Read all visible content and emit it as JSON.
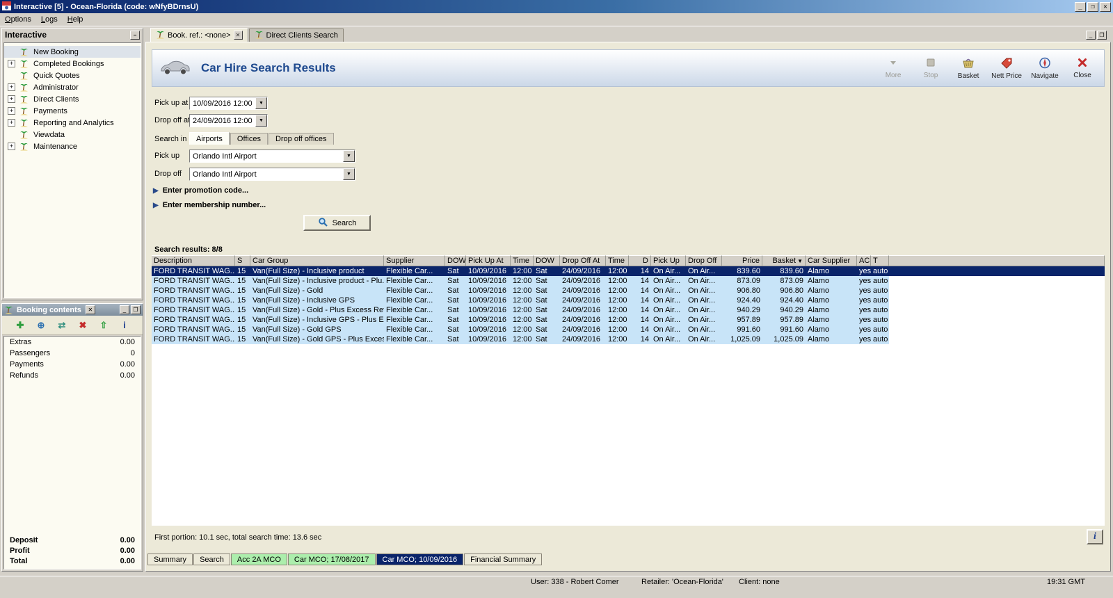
{
  "window": {
    "title": "Interactive [5] - Ocean-Florida (code: wNfyBDrnsU)"
  },
  "icons": {
    "minimize": "_",
    "maximize": "❐",
    "close": "✕",
    "collapse": "−",
    "expand": "+",
    "dropdown": "▼",
    "expander_arrow": "▶",
    "sort": "▼",
    "info": "i"
  },
  "menu": {
    "items": [
      "Options",
      "Logs",
      "Help"
    ]
  },
  "sidebar": {
    "title": "Interactive",
    "items": [
      {
        "label": "New Booking",
        "expandable": false,
        "selected": true
      },
      {
        "label": "Completed Bookings",
        "expandable": true,
        "selected": false
      },
      {
        "label": "Quick Quotes",
        "expandable": false,
        "selected": false
      },
      {
        "label": "Administrator",
        "expandable": true,
        "selected": false
      },
      {
        "label": "Direct Clients",
        "expandable": true,
        "selected": false
      },
      {
        "label": "Payments",
        "expandable": true,
        "selected": false
      },
      {
        "label": "Reporting and Analytics",
        "expandable": true,
        "selected": false
      },
      {
        "label": "Viewdata",
        "expandable": false,
        "selected": false
      },
      {
        "label": "Maintenance",
        "expandable": true,
        "selected": false
      }
    ]
  },
  "booking_panel": {
    "title": "Booking contents",
    "toolbar": [
      {
        "name": "add-icon",
        "glyph": "✚",
        "color": "#2f9e3f"
      },
      {
        "name": "globe-icon",
        "glyph": "⊕",
        "color": "#2a6fb0"
      },
      {
        "name": "transfer-icon",
        "glyph": "⇄",
        "color": "#2f8e7e"
      },
      {
        "name": "delete-icon",
        "glyph": "✖",
        "color": "#c42b2b"
      },
      {
        "name": "move-up-icon",
        "glyph": "⇧",
        "color": "#2f9e3f"
      },
      {
        "name": "info-icon",
        "glyph": "i",
        "color": "#1f3f8f"
      }
    ],
    "rows": [
      {
        "label": "Extras",
        "value": "0.00"
      },
      {
        "label": "Passengers",
        "value": "0"
      },
      {
        "label": "Payments",
        "value": "0.00"
      },
      {
        "label": "Refunds",
        "value": "0.00"
      }
    ],
    "totals": [
      {
        "label": "Deposit",
        "value": "0.00"
      },
      {
        "label": "Profit",
        "value": "0.00"
      },
      {
        "label": "Total",
        "value": "0.00"
      }
    ]
  },
  "doc_tabs": [
    {
      "label": "Book. ref.: <none>",
      "active": true,
      "closable": true
    },
    {
      "label": "Direct Clients Search",
      "active": false,
      "closable": false
    }
  ],
  "header": {
    "title": "Car Hire Search Results",
    "buttons": [
      {
        "label": "More",
        "icon": "more-icon",
        "disabled": true
      },
      {
        "label": "Stop",
        "icon": "stop-icon",
        "disabled": true
      },
      {
        "label": "Basket",
        "icon": "basket-icon",
        "disabled": false
      },
      {
        "label": "Nett Price",
        "icon": "nett-price-icon",
        "disabled": false
      },
      {
        "label": "Navigate",
        "icon": "navigate-icon",
        "disabled": false
      },
      {
        "label": "Close",
        "icon": "close-red-icon",
        "disabled": false
      }
    ]
  },
  "search_form": {
    "pickup_at_label": "Pick up at",
    "pickup_at_value": "10/09/2016 12:00",
    "dropoff_at_label": "Drop off at",
    "dropoff_at_value": "24/09/2016 12:00",
    "search_in_label": "Search in",
    "search_in_tabs": [
      {
        "label": "Airports",
        "active": true
      },
      {
        "label": "Offices",
        "active": false
      },
      {
        "label": "Drop off offices",
        "active": false
      }
    ],
    "pickup_label": "Pick up",
    "pickup_value": "Orlando Intl Airport",
    "dropoff_label": "Drop off",
    "dropoff_value": "Orlando Intl Airport",
    "promotion": "Enter promotion code...",
    "membership": "Enter membership number...",
    "search_button": "Search"
  },
  "results": {
    "summary": "Search results: 8/8",
    "columns": [
      {
        "label": "Description"
      },
      {
        "label": "S"
      },
      {
        "label": "Car Group"
      },
      {
        "label": "Supplier"
      },
      {
        "label": "DOW"
      },
      {
        "label": "Pick Up At"
      },
      {
        "label": "Time"
      },
      {
        "label": "DOW"
      },
      {
        "label": "Drop Off At"
      },
      {
        "label": "Time"
      },
      {
        "label": "D"
      },
      {
        "label": "Pick Up"
      },
      {
        "label": "Drop Off"
      },
      {
        "label": "Price"
      },
      {
        "label": "Basket",
        "sorted": true
      },
      {
        "label": "Car Supplier"
      },
      {
        "label": "AC"
      },
      {
        "label": "T"
      }
    ],
    "rows": [
      {
        "selected": true,
        "cells": [
          "FORD TRANSIT WAG...",
          "15",
          "Van(Full Size) - Inclusive product",
          "Flexible Car...",
          "Sat",
          "10/09/2016",
          "12:00",
          "Sat",
          "24/09/2016",
          "12:00",
          "14",
          "On Air...",
          "On Air...",
          "839.60",
          "839.60",
          "Alamo",
          "yes",
          "auto"
        ]
      },
      {
        "selected": false,
        "cells": [
          "FORD TRANSIT WAG...",
          "15",
          "Van(Full Size) - Inclusive product - Plu...",
          "Flexible Car...",
          "Sat",
          "10/09/2016",
          "12:00",
          "Sat",
          "24/09/2016",
          "12:00",
          "14",
          "On Air...",
          "On Air...",
          "873.09",
          "873.09",
          "Alamo",
          "yes",
          "auto"
        ]
      },
      {
        "selected": false,
        "cells": [
          "FORD TRANSIT WAG...",
          "15",
          "Van(Full Size) - Gold",
          "Flexible Car...",
          "Sat",
          "10/09/2016",
          "12:00",
          "Sat",
          "24/09/2016",
          "12:00",
          "14",
          "On Air...",
          "On Air...",
          "906.80",
          "906.80",
          "Alamo",
          "yes",
          "auto"
        ]
      },
      {
        "selected": false,
        "cells": [
          "FORD TRANSIT WAG...",
          "15",
          "Van(Full Size) - Inclusive GPS",
          "Flexible Car...",
          "Sat",
          "10/09/2016",
          "12:00",
          "Sat",
          "24/09/2016",
          "12:00",
          "14",
          "On Air...",
          "On Air...",
          "924.40",
          "924.40",
          "Alamo",
          "yes",
          "auto"
        ]
      },
      {
        "selected": false,
        "cells": [
          "FORD TRANSIT WAG...",
          "15",
          "Van(Full Size) - Gold - Plus Excess Ref...",
          "Flexible Car...",
          "Sat",
          "10/09/2016",
          "12:00",
          "Sat",
          "24/09/2016",
          "12:00",
          "14",
          "On Air...",
          "On Air...",
          "940.29",
          "940.29",
          "Alamo",
          "yes",
          "auto"
        ]
      },
      {
        "selected": false,
        "cells": [
          "FORD TRANSIT WAG...",
          "15",
          "Van(Full Size) - Inclusive GPS - Plus Ex...",
          "Flexible Car...",
          "Sat",
          "10/09/2016",
          "12:00",
          "Sat",
          "24/09/2016",
          "12:00",
          "14",
          "On Air...",
          "On Air...",
          "957.89",
          "957.89",
          "Alamo",
          "yes",
          "auto"
        ]
      },
      {
        "selected": false,
        "cells": [
          "FORD TRANSIT WAG...",
          "15",
          "Van(Full Size) - Gold GPS",
          "Flexible Car...",
          "Sat",
          "10/09/2016",
          "12:00",
          "Sat",
          "24/09/2016",
          "12:00",
          "14",
          "On Air...",
          "On Air...",
          "991.60",
          "991.60",
          "Alamo",
          "yes",
          "auto"
        ]
      },
      {
        "selected": false,
        "cells": [
          "FORD TRANSIT WAG...",
          "15",
          "Van(Full Size) - Gold GPS - Plus Excess...",
          "Flexible Car...",
          "Sat",
          "10/09/2016",
          "12:00",
          "Sat",
          "24/09/2016",
          "12:00",
          "14",
          "On Air...",
          "On Air...",
          "1,025.09",
          "1,025.09",
          "Alamo",
          "yes",
          "auto"
        ]
      }
    ]
  },
  "status_line": {
    "text": "First portion: 10.1 sec, total search time: 13.6 sec"
  },
  "bottom_tabs": [
    {
      "label": "Summary",
      "style": "plain"
    },
    {
      "label": "Search",
      "style": "plain"
    },
    {
      "label": "Acc 2A MCO",
      "style": "green"
    },
    {
      "label": "Car MCO; 17/08/2017",
      "style": "green"
    },
    {
      "label": "Car MCO; 10/09/2016",
      "style": "active"
    },
    {
      "label": "Financial Summary",
      "style": "plain"
    }
  ],
  "status_bar": {
    "user": "User: 338 - Robert Comer",
    "retailer": "Retailer: 'Ocean-Florida'",
    "client": "Client: none",
    "time": "19:31 GMT"
  }
}
